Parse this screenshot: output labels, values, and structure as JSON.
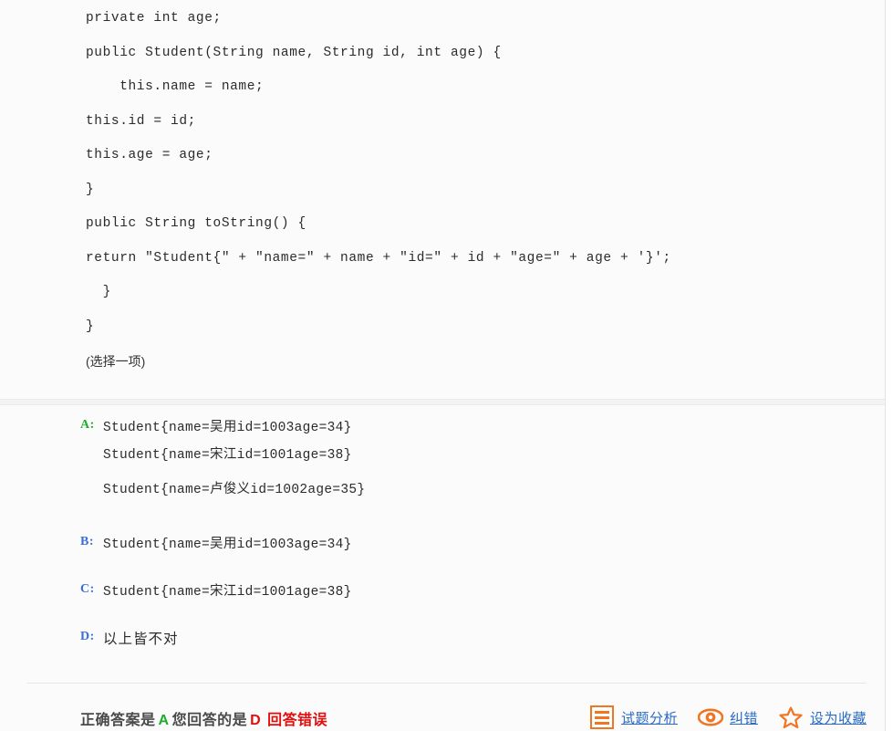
{
  "question": {
    "code_lines": [
      "private int age;",
      "public Student(String name, String id, int age) {",
      "    this.name = name;",
      "this.id = id;",
      "this.age = age;",
      "}",
      "public String toString() {",
      "return \"Student{\" + \"name=\" + name + \"id=\" + id + \"age=\" + age + '}';",
      "  }",
      "}"
    ],
    "instruction": "(选择一项)"
  },
  "options": [
    {
      "label": "A:",
      "label_color": "#1fab2b",
      "is_correct": true,
      "lines": [
        "Student{name=吴用id=1003age=34}",
        "Student{name=宋江id=1001age=38}",
        "Student{name=卢俊义id=1002age=35}"
      ]
    },
    {
      "label": "B:",
      "label_color": "#3a6fd8",
      "is_correct": false,
      "lines": [
        "Student{name=吴用id=1003age=34}"
      ]
    },
    {
      "label": "C:",
      "label_color": "#3a6fd8",
      "is_correct": false,
      "lines": [
        "Student{name=宋江id=1001age=38}"
      ]
    },
    {
      "label": "D:",
      "label_color": "#3a6fd8",
      "is_correct": false,
      "cjk": true,
      "lines": [
        "以上皆不对"
      ]
    }
  ],
  "footer": {
    "correct_prefix": "正确答案是",
    "correct_answer": "A",
    "your_prefix": "您回答的是",
    "your_answer": "D",
    "result_text": "回答错误",
    "actions": [
      {
        "icon": "document-list-icon",
        "label": "试题分析"
      },
      {
        "icon": "eye-icon",
        "label": "纠错"
      },
      {
        "icon": "star-icon",
        "label": "设为收藏"
      }
    ]
  },
  "colors": {
    "correct_green": "#1fab2b",
    "wrong_red": "#e30d0d",
    "link_blue": "#2b6bc4",
    "icon_orange": "#ef7622",
    "option_blue": "#3a6fd8"
  }
}
